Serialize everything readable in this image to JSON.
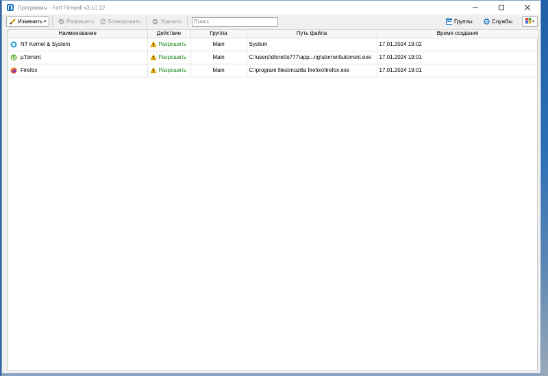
{
  "window": {
    "title": "Программы - Fort Firewall v3.10.12",
    "minimize_icon": "minimize-icon",
    "maximize_icon": "maximize-icon",
    "close_icon": "close-icon"
  },
  "toolbar": {
    "edit_label": "Изменить",
    "allow_label": "Разрешить",
    "block_label": "Блокировать",
    "delete_label": "Удалить",
    "search_placeholder": "Поиск",
    "groups_label": "Группы",
    "services_label": "Службы"
  },
  "table": {
    "headers": [
      "Наименование",
      "Действие",
      "Группа",
      "Путь файла",
      "Время создания"
    ],
    "rows": [
      {
        "name": "NT Kernel & System",
        "icon": "system-icon",
        "action": "Разрешить",
        "group": "Main",
        "path": "System",
        "created": "17.01.2024 19:02"
      },
      {
        "name": "µTorrent",
        "icon": "utorrent-icon",
        "action": "Разрешить",
        "group": "Main",
        "path": "C:\\users\\dtoretto777\\app...ng\\utorrent\\utorrent.exe",
        "created": "17.01.2024 19:01"
      },
      {
        "name": "Firefox",
        "icon": "firefox-icon",
        "action": "Разрешить",
        "group": "Main",
        "path": "C:\\program files\\mozilla firefox\\firefox.exe",
        "created": "17.01.2024 19:01"
      }
    ]
  },
  "colors": {
    "allow_text": "#1d8a1d",
    "accent": "#1f75c4",
    "warning": "#f0b400"
  }
}
